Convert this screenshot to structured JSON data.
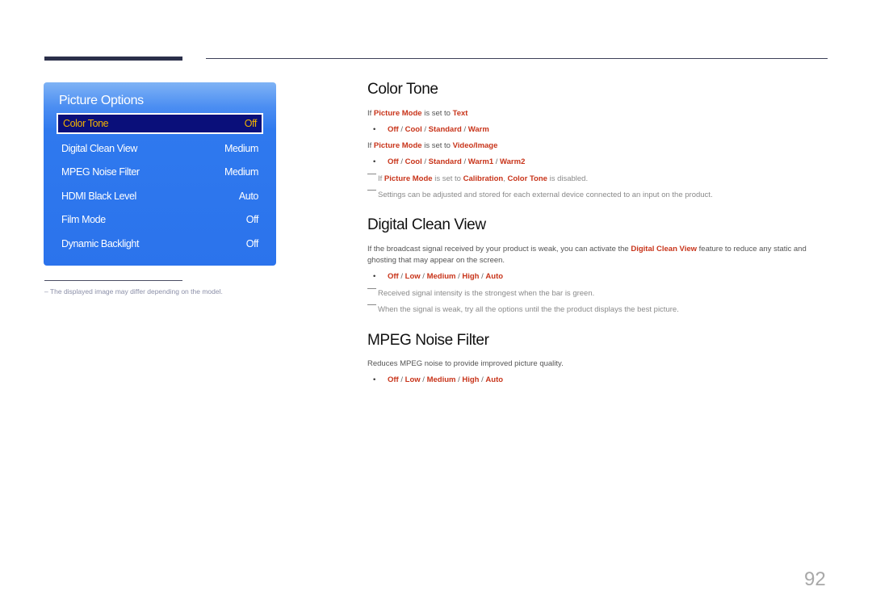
{
  "osd": {
    "title": "Picture Options",
    "items": [
      {
        "label": "Color Tone",
        "value": "Off",
        "selected": true
      },
      {
        "label": "Digital Clean View",
        "value": "Medium"
      },
      {
        "label": "MPEG Noise Filter",
        "value": "Medium"
      },
      {
        "label": "HDMI Black Level",
        "value": "Auto"
      },
      {
        "label": "Film Mode",
        "value": "Off"
      },
      {
        "label": "Dynamic Backlight",
        "value": "Off"
      }
    ]
  },
  "footnote": "–  The displayed image may differ depending on the model.",
  "sections": {
    "color_tone": {
      "title": "Color Tone",
      "cond1": {
        "prefix": "If ",
        "key": "Picture Mode",
        "mid": " is set to ",
        "value": "Text"
      },
      "options1": [
        "Off",
        "Cool",
        "Standard",
        "Warm"
      ],
      "cond2": {
        "prefix": "If ",
        "key": "Picture Mode",
        "mid": " is set to ",
        "value": "Video/Image"
      },
      "options2": [
        "Off",
        "Cool",
        "Standard",
        "Warm1",
        "Warm2"
      ],
      "note1": {
        "prefix": "If ",
        "key": "Picture Mode",
        "mid": " is set to ",
        "value": "Calibration",
        "comma": ", ",
        "item": "Color Tone",
        "suffix": " is disabled."
      },
      "note2": "Settings can be adjusted and stored for each external device connected to an input on the product."
    },
    "digital_clean_view": {
      "title": "Digital Clean View",
      "desc_before": "If the broadcast signal received by your product is weak, you can activate the ",
      "desc_highlight": "Digital Clean View",
      "desc_after": " feature to reduce any static and ghosting that may appear on the screen.",
      "options": [
        "Off",
        "Low",
        "Medium",
        "High",
        "Auto"
      ],
      "note1": "Received signal intensity is the strongest when the bar is green.",
      "note2": "When the signal is weak, try all the options until the the product displays the best picture."
    },
    "mpeg_noise_filter": {
      "title": "MPEG Noise Filter",
      "desc": "Reduces MPEG noise to provide improved picture quality.",
      "options": [
        "Off",
        "Low",
        "Medium",
        "High",
        "Auto"
      ]
    }
  },
  "page_number": "92",
  "colors": {
    "highlight": "#c8341a",
    "osd_blue": "#2b73ec",
    "osd_selected": "#0a0f7a",
    "osd_selected_text": "#f2b100"
  }
}
